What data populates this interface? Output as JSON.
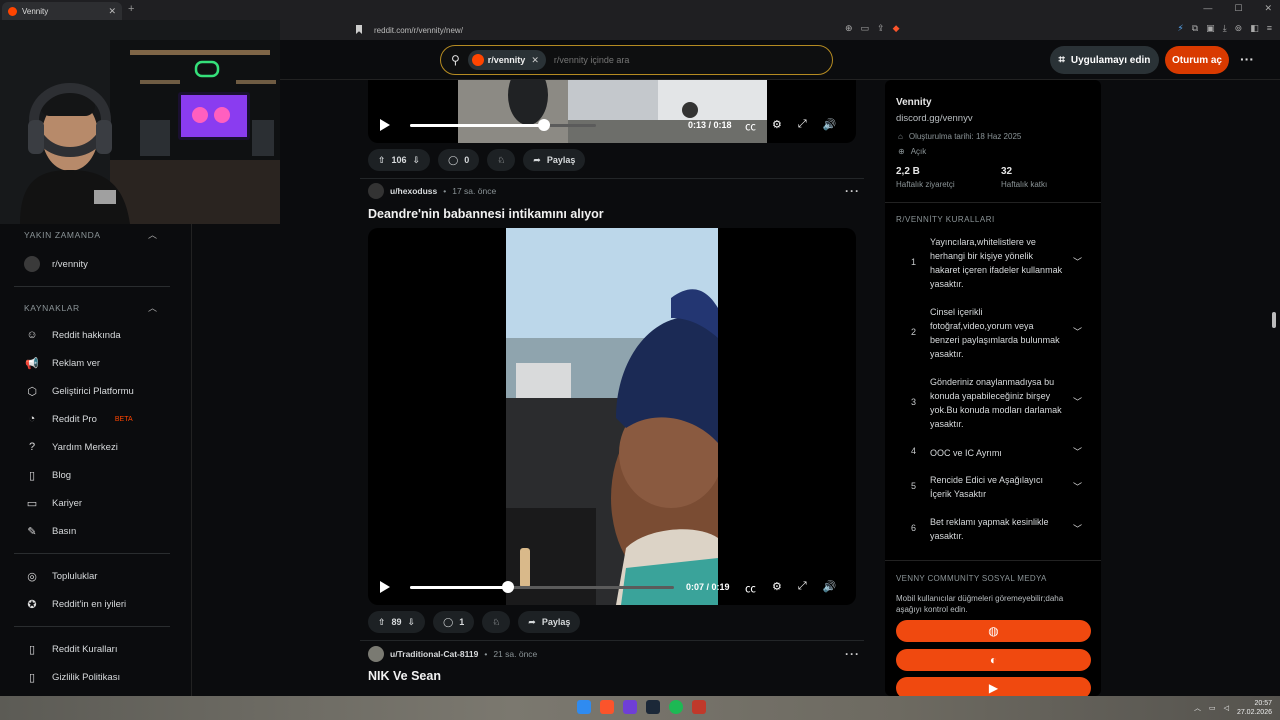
{
  "browser": {
    "tab_title": "Vennity",
    "url": "reddit.com/r/vennity/new/"
  },
  "header": {
    "search_chip": "r/vennity",
    "search_placeholder": "r/vennity içinde ara",
    "get_app": "Uygulamayı edin",
    "login": "Oturum aç"
  },
  "sidebar": {
    "recent_header": "YAKIN ZAMANDA",
    "recent_items": [
      {
        "label": "r/vennity"
      }
    ],
    "resources_header": "KAYNAKLAR",
    "resources": [
      {
        "label": "Reddit hakkında",
        "icon": "reddit-icon"
      },
      {
        "label": "Reklam ver",
        "icon": "megaphone-icon"
      },
      {
        "label": "Geliştirici Platformu",
        "icon": "hexagon-icon"
      },
      {
        "label": "Reddit Pro",
        "badge": "BETA",
        "icon": "pro-icon"
      },
      {
        "label": "Yardım Merkezi",
        "icon": "help-icon"
      },
      {
        "label": "Blog",
        "icon": "book-icon"
      },
      {
        "label": "Kariyer",
        "icon": "briefcase-icon"
      },
      {
        "label": "Basın",
        "icon": "mic-icon"
      }
    ],
    "community_links": [
      {
        "label": "Topluluklar",
        "icon": "communities-icon"
      },
      {
        "label": "Reddit'in en iyileri",
        "icon": "star-icon"
      }
    ],
    "policy_links": [
      {
        "label": "Reddit Kuralları",
        "icon": "book-icon"
      },
      {
        "label": "Gizlilik Politikası",
        "icon": "book-icon"
      }
    ]
  },
  "feed": {
    "posts": [
      {
        "video": {
          "current": "0:13",
          "duration": "0:18",
          "time_text": "0:13 / 0:18",
          "progress": 0.72
        },
        "votes": "106",
        "comments": "0",
        "share": "Paylaş"
      },
      {
        "user": "u/hexoduss",
        "time": "17 sa. önce",
        "title": "Deandre'nin babannesi intikamını alıyor",
        "video": {
          "current": "0:07",
          "duration": "0:19",
          "time_text": "0:07 / 0:19",
          "progress": 0.37
        },
        "votes": "89",
        "comments": "1",
        "share": "Paylaş"
      },
      {
        "user": "u/Traditional-Cat-8119",
        "time": "21 sa. önce",
        "title": "NIK Ve Sean"
      }
    ]
  },
  "community": {
    "name": "Vennity",
    "link": "discord.gg/vennyv",
    "created": "Oluşturulma tarihi: 18 Haz 2025",
    "visibility": "Açık",
    "stats": [
      {
        "value": "2,2 B",
        "label": "Haftalık ziyaretçi"
      },
      {
        "value": "32",
        "label": "Haftalık katkı"
      }
    ],
    "rules_header": "R/VENNİTY KURALLARI",
    "rules": [
      {
        "num": "1",
        "text": "Yayıncılara,whitelistlere ve herhangi bir kişiye yönelik hakaret içeren ifadeler kullanmak yasaktır."
      },
      {
        "num": "2",
        "text": "Cinsel içerikli fotoğraf,video,yorum veya benzeri paylaşımlarda bulunmak yasaktır."
      },
      {
        "num": "3",
        "text": "Gönderiniz onaylanmadıysa bu konuda yapabileceğiniz birşey yok.Bu konuda modları darlamak yasaktır."
      },
      {
        "num": "4",
        "text": "OOC ve IC Ayrımı"
      },
      {
        "num": "5",
        "text": "Rencide Edici ve Aşağılayıcı İçerik Yasaktır"
      },
      {
        "num": "6",
        "text": "Bet reklamı yapmak kesinlikle yasaktır."
      }
    ],
    "social_header": "VENNY COMMUNİTY SOSYAL MEDYA",
    "social_desc": "Mobil kullanıcılar düğmeleri göremeyebilir;daha aşağıyı kontrol edin."
  },
  "taskbar": {
    "time": "20:57",
    "date": "27.02.2026"
  },
  "colors": {
    "accent": "#ff4500",
    "login_bg": "#d93a00",
    "search_border": "#b58b22"
  }
}
